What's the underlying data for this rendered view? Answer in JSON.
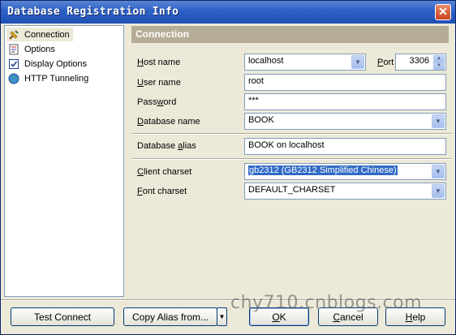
{
  "window": {
    "title": "Database Registration Info",
    "close_glyph": "✕"
  },
  "nav": {
    "items": [
      {
        "label": "Connection",
        "icon": "connection-plug-icon",
        "selected": true
      },
      {
        "label": "Options",
        "icon": "options-page-icon",
        "selected": false
      },
      {
        "label": "Display Options",
        "icon": "display-options-checkbox-icon",
        "selected": false
      },
      {
        "label": "HTTP Tunneling",
        "icon": "http-globe-icon",
        "selected": false
      }
    ]
  },
  "panel": {
    "header": "Connection",
    "host_name": {
      "label_pre": "",
      "label_u": "H",
      "label_post": "ost name",
      "value": "localhost"
    },
    "port": {
      "label_pre": "",
      "label_u": "P",
      "label_post": "ort",
      "value": "3306"
    },
    "user_name": {
      "label_pre": "",
      "label_u": "U",
      "label_post": "ser name",
      "value": "root"
    },
    "password": {
      "label_pre": "Pass",
      "label_u": "w",
      "label_post": "ord",
      "value": "***"
    },
    "database_name": {
      "label_pre": "",
      "label_u": "D",
      "label_post": "atabase name",
      "value": "BOOK"
    },
    "database_alias": {
      "label_pre": "Database ",
      "label_u": "a",
      "label_post": "lias",
      "value": "BOOK on localhost"
    },
    "client_charset": {
      "label_pre": "",
      "label_u": "C",
      "label_post": "lient charset",
      "value": "gb2312 (GB2312 Simplified Chinese)"
    },
    "font_charset": {
      "label_pre": "",
      "label_u": "F",
      "label_post": "ont charset",
      "value": "DEFAULT_CHARSET"
    }
  },
  "buttons": {
    "test_connect": "Test Connect",
    "copy_alias": "Copy Alias from...",
    "ok_u": "O",
    "ok_post": "K",
    "cancel_u": "C",
    "cancel_post": "ancel",
    "help_u": "H",
    "help_post": "elp"
  },
  "watermark": "chy710.cnblogs.com",
  "colors": {
    "title_bar": "#2f63c6",
    "panel_header": "#b4ac96",
    "selection": "#316ac5",
    "window_bg": "#ece9d8"
  }
}
